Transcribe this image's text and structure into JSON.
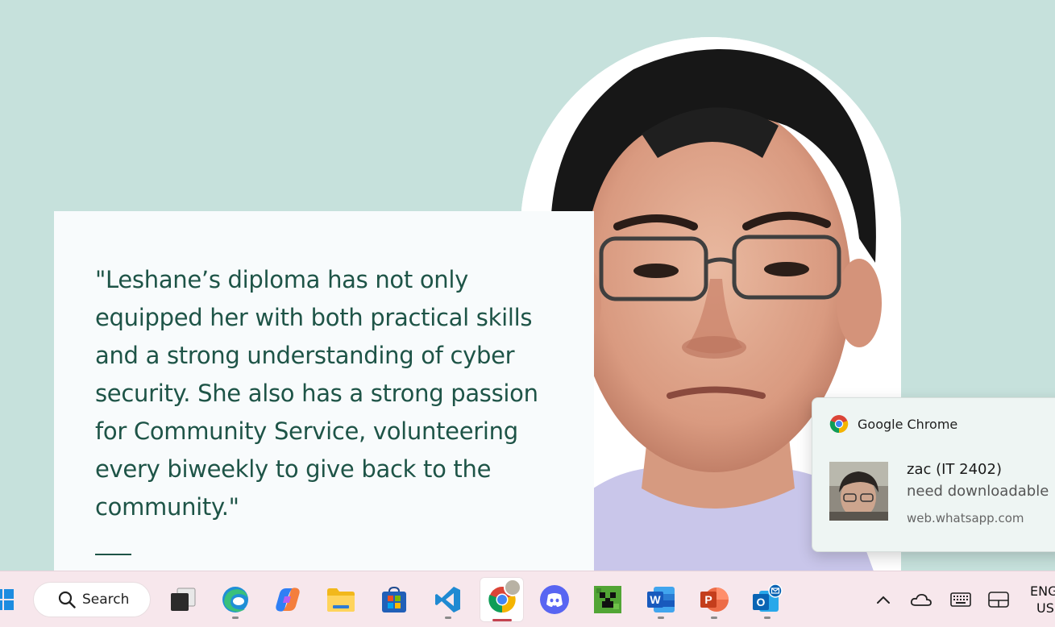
{
  "quote": {
    "text": "\"Leshane’s diploma has not only equipped her with both practical skills and a strong understanding of cyber security. She also has a strong passion for Community Service, volunteering every biweekly to give back to the community.\""
  },
  "notification": {
    "app_name": "Google Chrome",
    "title": "zac (IT 2402)",
    "message": "need downloadable",
    "source": "web.whatsapp.com"
  },
  "taskbar": {
    "search_label": "Search",
    "apps": [
      {
        "name": "task-view",
        "icon": "task-view-icon"
      },
      {
        "name": "edge",
        "icon": "edge-icon"
      },
      {
        "name": "copilot",
        "icon": "copilot-icon"
      },
      {
        "name": "file-explorer",
        "icon": "folder-icon"
      },
      {
        "name": "microsoft-store",
        "icon": "store-icon"
      },
      {
        "name": "vscode",
        "icon": "vscode-icon"
      },
      {
        "name": "chrome",
        "icon": "chrome-icon",
        "active": true
      },
      {
        "name": "discord",
        "icon": "discord-icon"
      },
      {
        "name": "minecraft",
        "icon": "minecraft-icon"
      },
      {
        "name": "word",
        "icon": "word-icon"
      },
      {
        "name": "powerpoint",
        "icon": "powerpoint-icon"
      },
      {
        "name": "outlook",
        "icon": "outlook-icon"
      }
    ],
    "tray": {
      "language": "ENG",
      "region": "US"
    }
  },
  "colors": {
    "background": "#c6e1dc",
    "quote_text": "#1e5447",
    "card": "#f8fbfc",
    "taskbar": "#f7e7ec",
    "active_indicator": "#c4424f"
  }
}
